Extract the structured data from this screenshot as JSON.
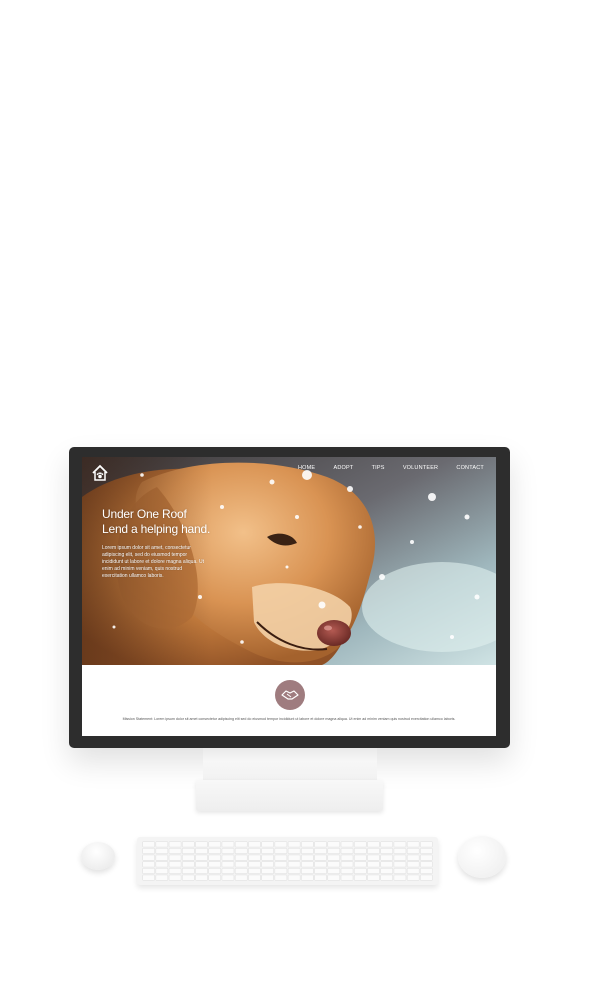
{
  "site": {
    "nav": {
      "items": [
        {
          "label": "HOME"
        },
        {
          "label": "ADOPT"
        },
        {
          "label": "TIPS"
        },
        {
          "label": "VOLUNTEER"
        },
        {
          "label": "CONTACT"
        }
      ]
    },
    "hero": {
      "title_line1": "Under One Roof",
      "title_line2": "Lend a helping hand.",
      "body": "Lorem ipsum dolor sit amet, consectetur adipiscing elit, sed do eiusmod tempor incididunt ut labore et dolore magna aliqua. Ut enim ad minim veniam, quis nostrud exercitation ullamco laboris."
    },
    "mission": {
      "text": "Mission Statement: Lorem ipsum dolor sit amet consectetur adipiscing elit sed do eiusmod tempor incididunt ut labore et dolore magna aliqua. Ut enim ad minim veniam quis nostrud exercitation ullamco laboris."
    }
  },
  "colors": {
    "mission_icon_bg": "#9f7c7f",
    "monitor_frame": "#2d2d2d"
  }
}
